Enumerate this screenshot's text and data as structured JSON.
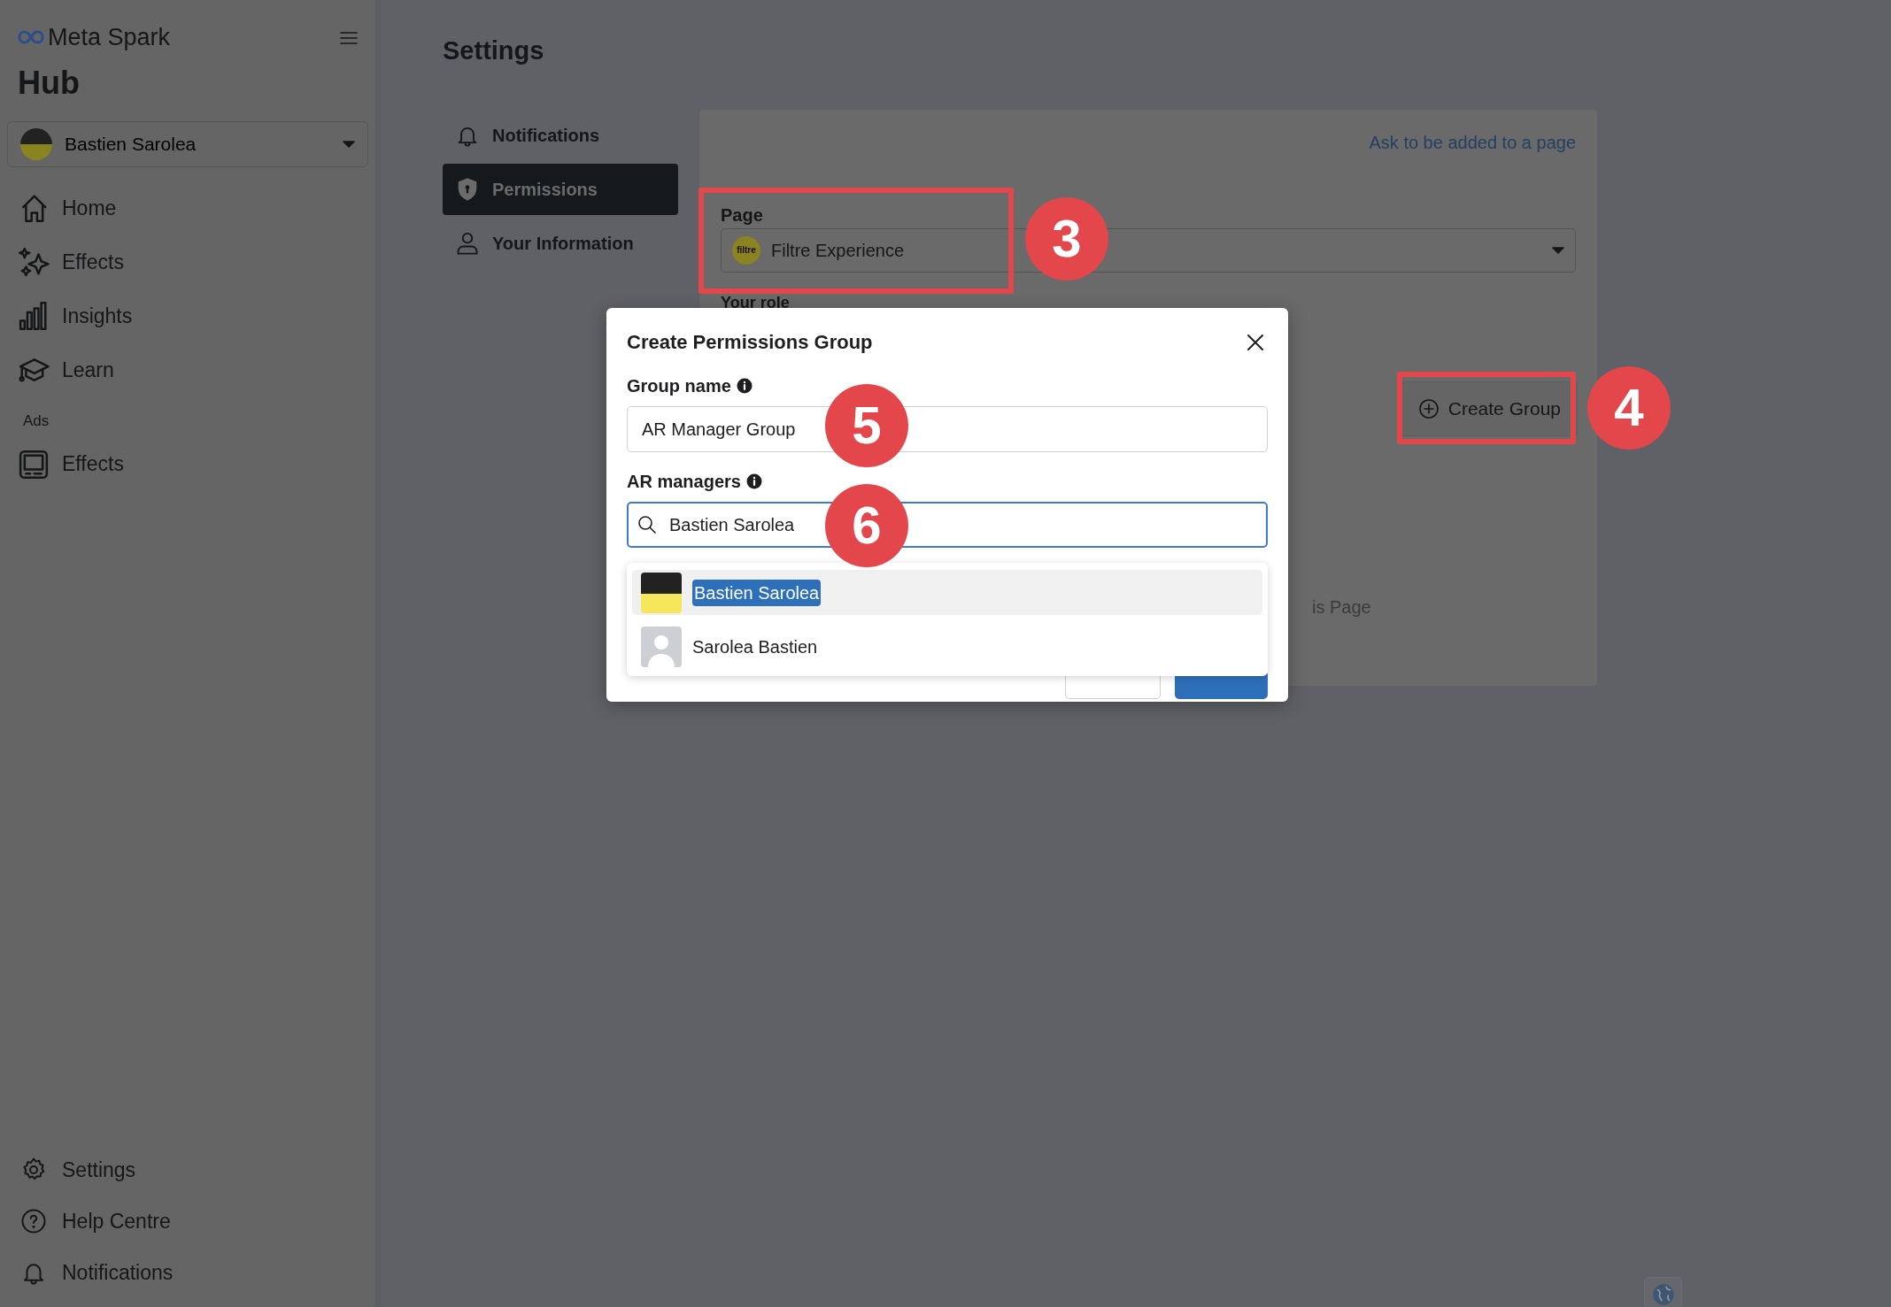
{
  "sidebar": {
    "brand": "Meta Spark",
    "title": "Hub",
    "account": {
      "name": "Bastien Sarolea"
    },
    "nav": [
      {
        "label": "Home"
      },
      {
        "label": "Effects"
      },
      {
        "label": "Insights"
      },
      {
        "label": "Learn"
      }
    ],
    "section_label": "Ads",
    "ads_nav": [
      {
        "label": "Effects"
      }
    ],
    "footer_nav": [
      {
        "label": "Settings"
      },
      {
        "label": "Help Centre"
      },
      {
        "label": "Notifications"
      }
    ]
  },
  "settings": {
    "title": "Settings",
    "tabs": [
      {
        "label": "Notifications",
        "selected": false
      },
      {
        "label": "Permissions",
        "selected": true
      },
      {
        "label": "Your Information",
        "selected": false
      }
    ],
    "card": {
      "link": "Ask to be added to a page",
      "page_label": "Page",
      "page_logo_text": "filtre",
      "page_value": "Filtre Experience",
      "role_label": "Your role",
      "create_button": "Create Group",
      "partial_text": "is Page"
    }
  },
  "dialog": {
    "title": "Create Permissions Group",
    "fields": [
      {
        "label": "Group name",
        "value": "AR Manager Group",
        "kind": "text",
        "focused": false
      },
      {
        "label": "AR managers",
        "value": "Bastien Sarolea",
        "kind": "search",
        "focused": true
      }
    ],
    "suggestions": [
      {
        "name": "Bastien Sarolea",
        "selected": true,
        "kind": "photo"
      },
      {
        "name": "Sarolea Bastien",
        "selected": false,
        "kind": "generic"
      }
    ]
  },
  "callouts": [
    {
      "label": "3",
      "boxed": true
    },
    {
      "label": "4",
      "boxed": true
    },
    {
      "label": "5"
    },
    {
      "label": "6"
    }
  ]
}
